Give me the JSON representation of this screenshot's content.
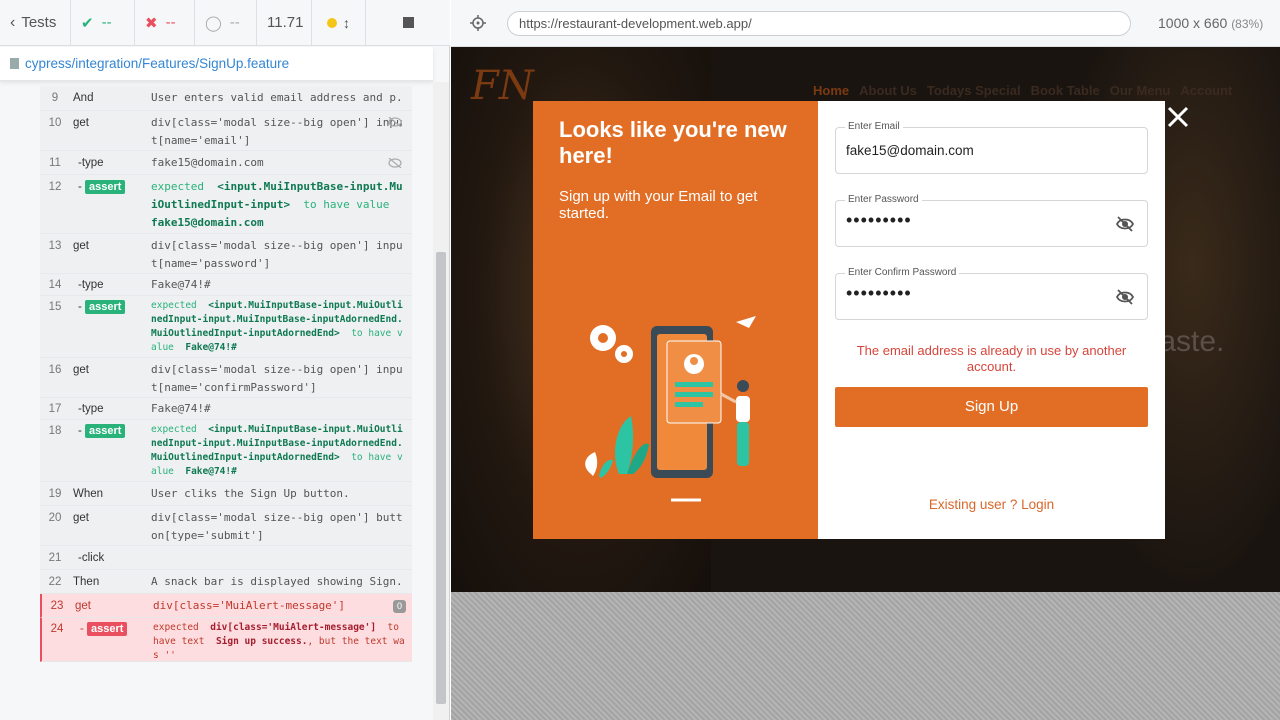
{
  "reporter": {
    "tests_label": "Tests",
    "passed": "--",
    "failed": "--",
    "pending": "--",
    "duration": "11.71",
    "spec_path": "cypress/integration/Features/SignUp.feature",
    "commands": [
      {
        "num": "9",
        "name": "And",
        "msg": "User enters valid email address and p..."
      },
      {
        "num": "10",
        "name": "get",
        "msg": "div[class='modal size--big open'] input[name='email']"
      },
      {
        "num": "11",
        "name": "-type",
        "msg": "fake15@domain.com"
      },
      {
        "num": "12",
        "name": "-",
        "badge": "assert",
        "expected": "expected",
        "el": "<input.MuiInputBase-input.MuiOutlinedInput-input>",
        "mid": "to have value",
        "val": "fake15@domain.com"
      },
      {
        "num": "13",
        "name": "get",
        "msg": "div[class='modal size--big open'] input[name='password']"
      },
      {
        "num": "14",
        "name": "-type",
        "msg": "Fake@74!#"
      },
      {
        "num": "15",
        "name": "-",
        "badge": "assert",
        "expected": "expected",
        "el": "<input.MuiInputBase-input.MuiOutlinedInput-input.MuiInputBase-inputAdornedEnd.MuiOutlinedInput-inputAdornedEnd>",
        "mid": "to have value",
        "val": "Fake@74!#"
      },
      {
        "num": "16",
        "name": "get",
        "msg": "div[class='modal size--big open'] input[name='confirmPassword']"
      },
      {
        "num": "17",
        "name": "-type",
        "msg": "Fake@74!#"
      },
      {
        "num": "18",
        "name": "-",
        "badge": "assert",
        "expected": "expected",
        "el": "<input.MuiInputBase-input.MuiOutlinedInput-input.MuiInputBase-inputAdornedEnd.MuiOutlinedInput-inputAdornedEnd>",
        "mid": "to have value",
        "val": "Fake@74!#"
      },
      {
        "num": "19",
        "name": "When",
        "msg": "User cliks the Sign Up button."
      },
      {
        "num": "20",
        "name": "get",
        "msg": "div[class='modal size--big open'] button[type='submit']"
      },
      {
        "num": "21",
        "name": "-click",
        "msg": ""
      },
      {
        "num": "22",
        "name": "Then",
        "msg": "A snack bar is displayed showing Sign..."
      },
      {
        "num": "23",
        "name": "get",
        "msg": "div[class='MuiAlert-message']",
        "count": "0"
      },
      {
        "num": "24",
        "name": "-",
        "badge": "assert",
        "expected": "expected",
        "el": "div[class='MuiAlert-message']",
        "mid": "to have text",
        "val": "Sign up success.",
        "tail": ", but the text was ''"
      }
    ]
  },
  "aut": {
    "url": "https://restaurant-development.web.app/",
    "viewport": "1000 x 660",
    "scale": "(83%)",
    "site": {
      "logo": "FN",
      "nav": [
        "Home",
        "About Us",
        "Todays Special",
        "Book Table",
        "Our Menu",
        "Account"
      ],
      "hero_text": "taste."
    },
    "modal": {
      "title": "Looks like you're new here!",
      "subtitle": "Sign up with your Email to get started.",
      "email_label": "Enter Email",
      "email_value": "fake15@domain.com",
      "password_label": "Enter Password",
      "password_value": "•••••••••",
      "confirm_label": "Enter Confirm Password",
      "confirm_value": "•••••••••",
      "error": "The email address is already in use by another account.",
      "signup_button": "Sign Up",
      "login_link": "Existing user ? Login"
    }
  },
  "colors": {
    "accent": "#e26e26",
    "pass": "#2ab27b",
    "fail": "#e94f5f",
    "error_text": "#d6453a"
  }
}
